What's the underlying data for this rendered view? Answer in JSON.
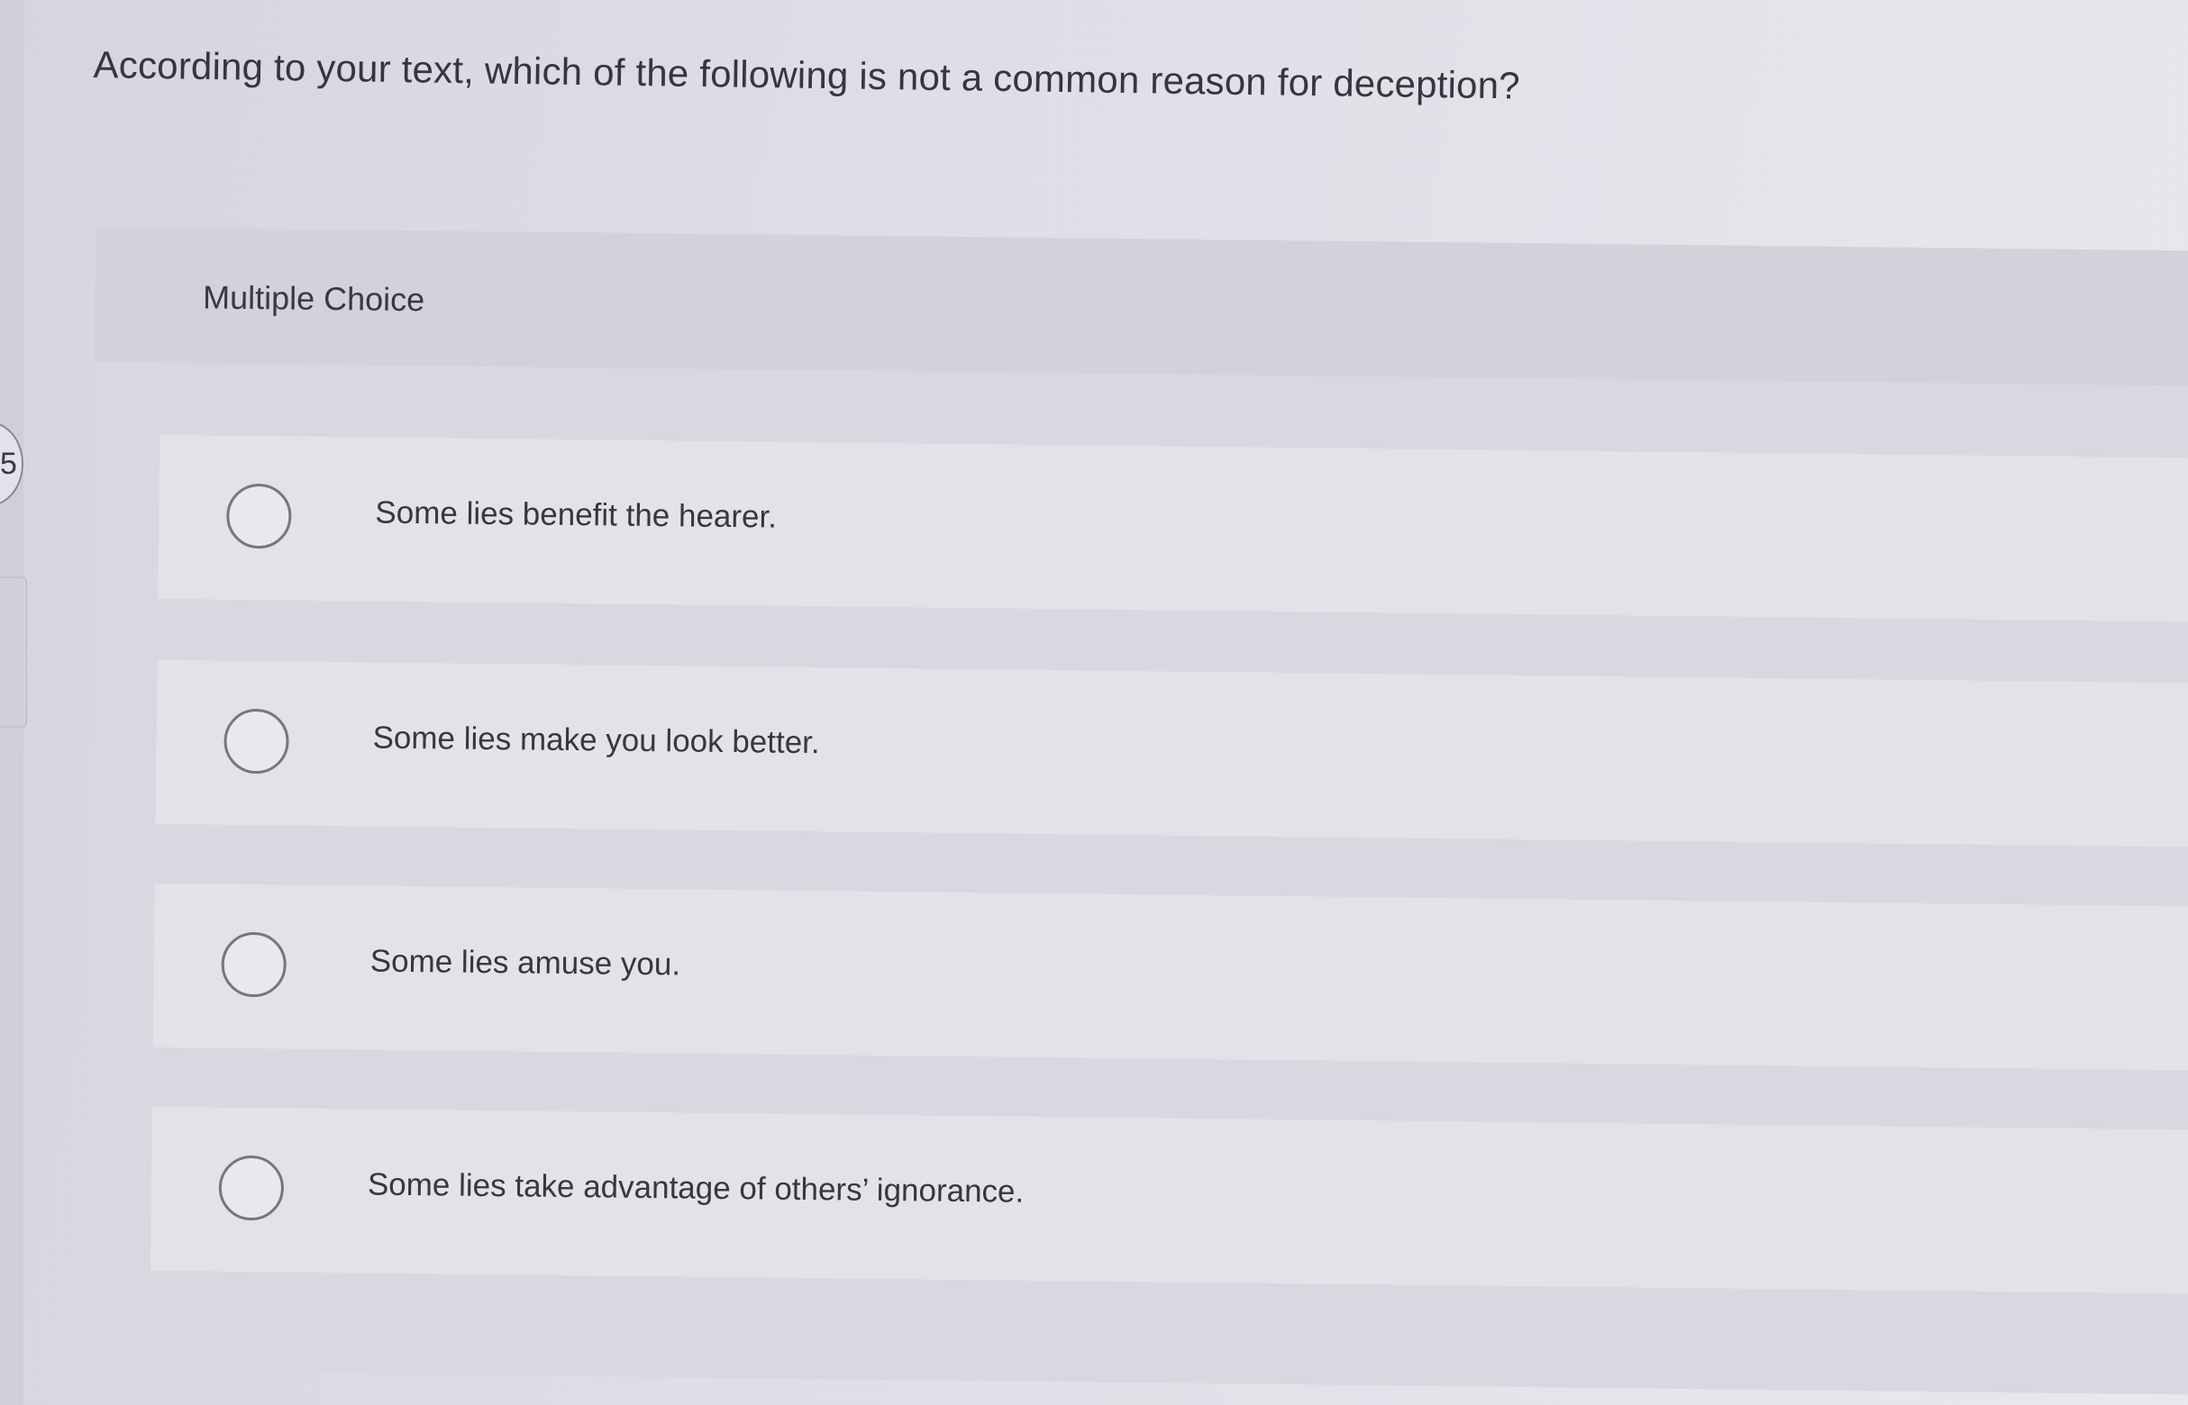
{
  "question": {
    "text": "According to your text, which of the following is not a common reason for deception?"
  },
  "nav": {
    "question_number_fragment": "5"
  },
  "multiple_choice": {
    "label": "Multiple Choice",
    "options": [
      {
        "label": "Some lies benefit the hearer.",
        "selected": false
      },
      {
        "label": "Some lies make you look better.",
        "selected": false
      },
      {
        "label": "Some lies amuse you.",
        "selected": false
      },
      {
        "label": "Some lies take advantage of others’ ignorance.",
        "selected": false
      }
    ]
  },
  "colors": {
    "background": "#dedde6",
    "panel": "#d9d8e0",
    "option_row": "#e3e2e9",
    "radio_border": "#77757f",
    "text": "#37353d"
  }
}
